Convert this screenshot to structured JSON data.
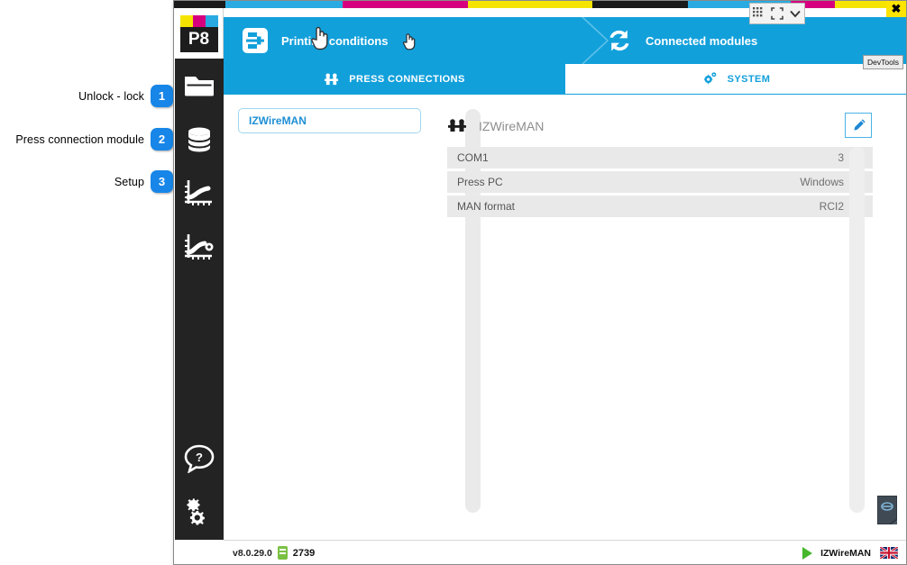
{
  "annotations": [
    {
      "label": "Unlock - lock",
      "number": "1"
    },
    {
      "label": "Press connection module",
      "number": "2"
    },
    {
      "label": "Setup",
      "number": "3"
    }
  ],
  "window": {
    "close_label": "✖",
    "devtools_tooltip": "DevTools",
    "dev_toolbar": {
      "grid_icon": "grid-icon",
      "expand_icon": "expand-icon",
      "chevron_icon": "chevron-down-icon"
    }
  },
  "logo": {
    "text": "P8",
    "bar_colors": [
      "#f5e400",
      "#d6007f",
      "#29abe2"
    ]
  },
  "rail": {
    "items": [
      {
        "name": "sidebar-item-folder",
        "icon": "folder-icon"
      },
      {
        "name": "sidebar-item-database",
        "icon": "database-icon"
      },
      {
        "name": "sidebar-item-curve",
        "icon": "curve-icon"
      },
      {
        "name": "sidebar-item-curve-setup",
        "icon": "curve-gear-icon"
      }
    ],
    "bottom": [
      {
        "name": "sidebar-item-help",
        "icon": "help-bubble-icon"
      },
      {
        "name": "sidebar-item-settings",
        "icon": "gears-icon"
      }
    ]
  },
  "breadcrumb": {
    "step1": {
      "label": "Printing conditions",
      "icon": "press-icon"
    },
    "step2": {
      "label": "Connected modules",
      "icon": "sync-icon"
    }
  },
  "tabs": [
    {
      "label": "PRESS CONNECTIONS",
      "icon": "press-connections-icon",
      "active": true
    },
    {
      "label": "SYSTEM",
      "icon": "gear-system-icon",
      "active": false
    }
  ],
  "module_list": {
    "items": [
      {
        "label": "IZWireMAN",
        "selected": true
      }
    ]
  },
  "detail": {
    "title": "IZWireMAN",
    "title_icon": "press-connections-icon",
    "edit_icon": "pencil-icon",
    "rows": [
      {
        "label": "COM1",
        "value": "3"
      },
      {
        "label": "Press PC",
        "value": "Windows"
      },
      {
        "label": "MAN format",
        "value": "RCI2"
      }
    ]
  },
  "footer": {
    "version": "v8.0.29.0",
    "dongle_icon": "usb-dongle-icon",
    "count": "2739",
    "play_icon": "play-icon",
    "module": "IZWireMAN",
    "flag_icon": "uk-flag-icon"
  },
  "colors": {
    "accent_blue": "#12a0db",
    "badge_blue": "#1786e8",
    "rail_dark": "#232323",
    "row_gray": "#e9e9e9",
    "green": "#46b72b"
  }
}
